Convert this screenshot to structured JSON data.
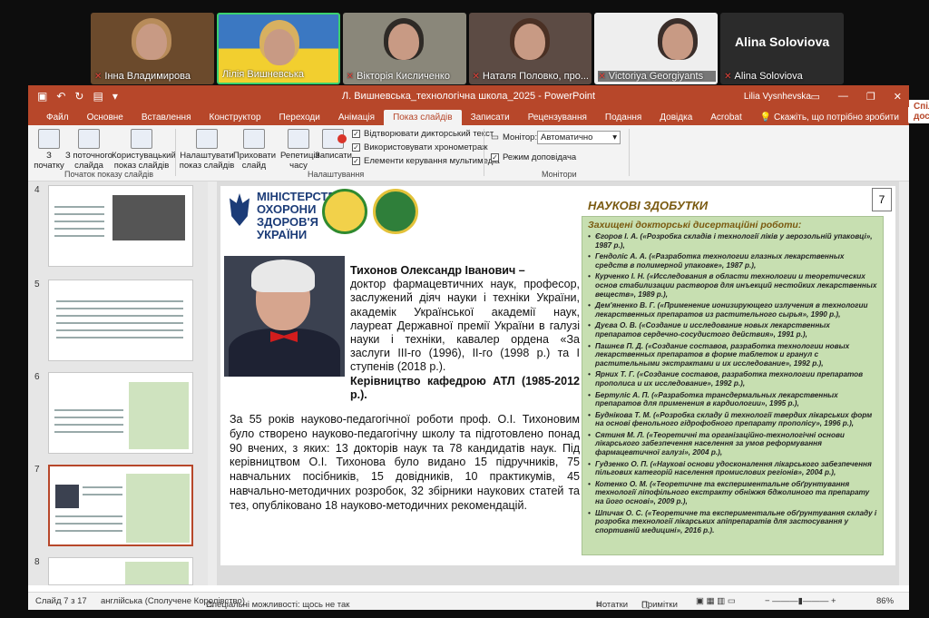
{
  "participants": [
    {
      "name": "Інна Владимирова",
      "muted": true,
      "bg": "#6b4a2c"
    },
    {
      "name": "Лілія Вишневська",
      "muted": false,
      "bg": "#3b78c2",
      "active": true
    },
    {
      "name": "Вікторія Кисличенко",
      "muted": true,
      "bg": "#7d7a6e"
    },
    {
      "name": "Наталя Половко, про...",
      "muted": true,
      "bg": "#5c4b44"
    },
    {
      "name": "Victoriya Georgiyants",
      "muted": true,
      "bg": "#eeeeee"
    },
    {
      "name": "Alina Soloviova",
      "muted": true,
      "bg": "#2b2b2b",
      "big_name": "Alina Soloviova"
    }
  ],
  "window": {
    "doc_title": "Л. Вишневська_технологічна школа_2025  -  PowerPoint",
    "user": "Lilia Vysnhevska"
  },
  "menu": {
    "tabs": [
      "Файл",
      "Основне",
      "Вставлення",
      "Конструктор",
      "Переходи",
      "Анімація",
      "Показ слайдів",
      "Записати",
      "Рецензування",
      "Подання",
      "Довідка",
      "Acrobat"
    ],
    "active": "Показ слайдів",
    "search": "Скажіть, що потрібно зробити",
    "share": "Спільний доступ"
  },
  "ribbon": {
    "from_start": "З\nпочатку",
    "from_current": "З поточного\nслайда",
    "custom_show": "Користувацький\nпоказ слайдів",
    "group1": "Початок показу слайдів",
    "setup": "Налаштувати\nпоказ слайдів",
    "hide": "Приховати\nслайд",
    "rehearse": "Репетиція\nчасу",
    "record": "Записати",
    "cb1": "Відтворювати дикторський текст",
    "cb2": "Використовувати хронометраж",
    "cb3": "Елементи керування мультимедіа",
    "group2": "Налаштування",
    "monitor_label": "Монітор:",
    "monitor_value": "Автоматично",
    "presenter": "Режим доповідача",
    "group3": "Монітори"
  },
  "thumbnails": [
    {
      "number": "4"
    },
    {
      "number": "5"
    },
    {
      "number": "6"
    },
    {
      "number": "7",
      "selected": true
    },
    {
      "number": "8"
    }
  ],
  "slide": {
    "number": "7",
    "ministry": "МІНІСТЕРСТВО ОХОРОНИ ЗДОРОВ'Я УКРАЇНИ",
    "name_line": "Тихонов Олександр Іванович –",
    "bio": "доктор фармацевтичних наук, професор, заслужений діяч науки і техніки України, академік Української академії наук, лауреат Державної премії України в галузі науки і техніки, кавалер ордена «За заслуги III-го (1996), II-го (1998 р.) та I ступенів (2018 р.).",
    "leadership": "Керівництво кафедрою АТЛ (1985-2012 р.).",
    "paragraph": "За 55 років науково-педагогічної роботи проф. О.І. Тихоновим було створено науково-педагогічну школу та підготовлено понад 90 вчених, з яких: 13 докторів наук та 78 кандидатів наук. Під керівництвом О.І. Тихонова було видано 15 підручників, 75 навчальних посібників, 15 довідників, 10 практикумів, 45 навчально-методичних розробок, 32 збірники наукових статей та тез, опубліковано 18 науково-методичних рекомендацій.",
    "achievements_title": "НАУКОВІ ЗДОБУТКИ",
    "theses_heading": "Захищені докторські дисертаційні роботи:",
    "theses": [
      "Єгоров І. А. («Розробка складів і технології ліків у аерозольній упаковці», 1987 р.),",
      "Гендоліс А. А. («Разработка технологии глазных лекарственных средств в полимерной упаковке», 1987 р.),",
      "Курченко І. Н. («Исследования в области технологии и теоретических основ стабилизации растворов для инъекций нестойких лекарственных веществ», 1989 р.),",
      "Дем'яненко В. Г. («Применение ионизирующего излучения в технологии лекарственных препаратов из растительного сырья», 1990 р.),",
      "Дуєва О. В. («Создание и исследование новых лекарственных препаратов сердечно-сосудистого действия», 1991 р.),",
      "Пашнєв П. Д. («Создание составов, разработка технологии новых лекарственных препаратов в форме таблеток и гранул с растительными экстрактами и их исследование», 1992 р.),",
      "Ярних Т. Г. («Создание составов, разработка технологии препаратов прополиса и их исследование», 1992 р.),",
      "Бертуліс А. П. («Разработка трансдермальных лекарственных препаратов для применения в кардиологии», 1995 р.),",
      "Буднікова Т. М. («Розробка складу й технології твердих лікарських форм на основі фенольного гідрофобного препарату прополісу», 1996 р.),",
      "Сятиня М. Л. («Теоретичні та організаційно-технологічні основи лікарського забезпечення населення за умов реформування фармацевтичної галузі», 2004 р.),",
      "Гудзенко О. П. («Наукові основи удосконалення лікарського забезпечення пільгових категорій населення промислових регіонів», 2004 р.),",
      "Котенко О. М. («Теоретичне та експериментальне обґрунтування технології ліпофільного екстракту обніжжя бджолиного та препарату на його основі», 2009 р.),",
      "Шпичак О. С. («Теоретичне та експериментальне обґрунтування складу і розробка технології лікарських апіпрепаратів для застосування у спортивній медицині», 2016 р.)."
    ]
  },
  "status": {
    "slide": "Слайд 7 з 17",
    "lang": "англійська (Сполучене Королівство)",
    "access": "Спеціальні можливості: щось не так",
    "notes": "Нотатки",
    "comments": "Примітки",
    "zoom": "86%"
  },
  "colors": {
    "accent": "#b7472a",
    "green_box": "#c7dfb1",
    "heading_gold": "#7a5a10"
  }
}
